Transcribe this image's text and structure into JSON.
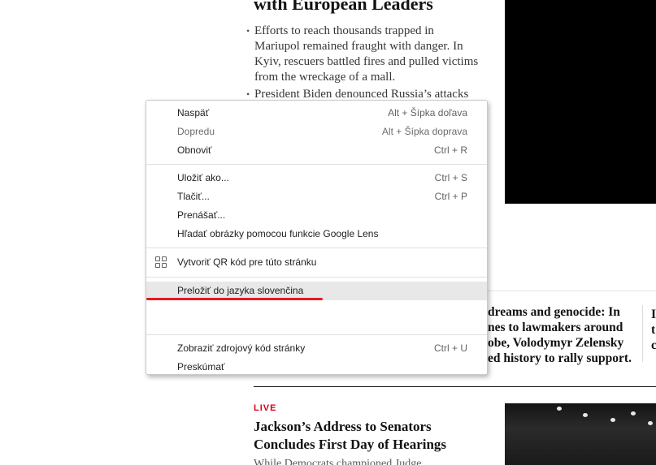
{
  "article_top": {
    "headline": "with European Leaders",
    "bullets": [
      [
        "Efforts to reach thousands trapped in",
        "Mariupol remained fraught with danger. In",
        "Kyiv, rescuers battled fires and pulled victims",
        "from the wreckage of a mall."
      ],
      [
        "President Biden denounced Russia’s attacks"
      ]
    ]
  },
  "story_mid": {
    "lines": [
      "dreams and genocide: In",
      "nes to lawmakers around",
      "obe, Volodymyr Zelensky",
      "ed history to rally support."
    ]
  },
  "live_story": {
    "label": "LIVE",
    "headline_lines": [
      "Jackson’s Address to Senators",
      "Concludes First Day of Hearings"
    ],
    "summary": "While Democrats championed Judge"
  },
  "context_menu": {
    "back": {
      "label": "Naspäť",
      "shortcut": "Alt + Šípka doľava"
    },
    "forward": {
      "label": "Dopredu",
      "shortcut": "Alt + Šípka doprava"
    },
    "reload": {
      "label": "Obnoviť",
      "shortcut": "Ctrl + R"
    },
    "save_as": {
      "label": "Uložiť ako...",
      "shortcut": "Ctrl + S"
    },
    "print": {
      "label": "Tlačiť...",
      "shortcut": "Ctrl + P"
    },
    "cast": {
      "label": "Prenášať..."
    },
    "lens": {
      "label": "Hľadať obrázky pomocou funkcie Google Lens"
    },
    "qr": {
      "label": "Vytvoriť QR kód pre túto stránku",
      "icon": "qr-code-icon"
    },
    "translate": {
      "label": "Preložiť do jazyka slovenčina"
    },
    "view_source": {
      "label": "Zobraziť zdrojový kód stránky",
      "shortcut": "Ctrl + U"
    },
    "inspect": {
      "label": "Preskúmať"
    }
  },
  "colors": {
    "live_red": "#d0021b",
    "annotation_red": "#e31b23",
    "menu_highlight": "#e8e8e8"
  }
}
